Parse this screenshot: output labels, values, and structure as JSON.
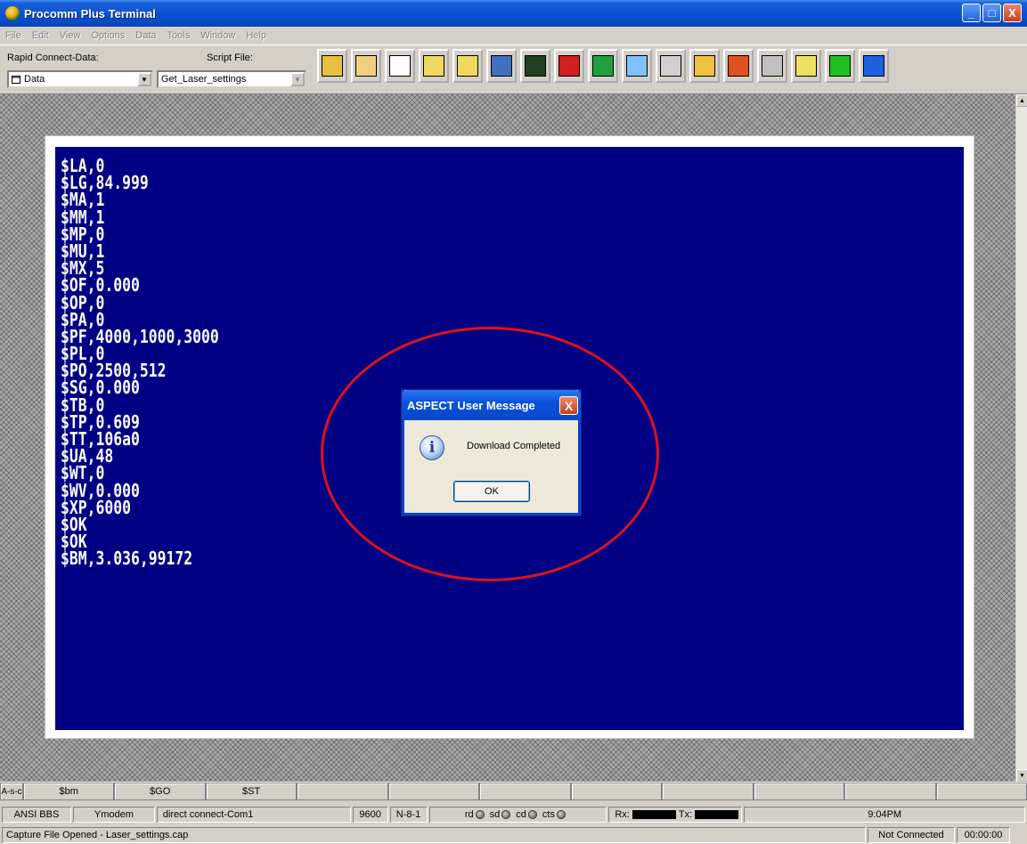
{
  "window": {
    "title": "Procomm Plus Terminal",
    "controls": {
      "minimize": "_",
      "maximize": "□",
      "close": "X"
    }
  },
  "menu": [
    "File",
    "Edit",
    "View",
    "Options",
    "Data",
    "Tools",
    "Window",
    "Help"
  ],
  "toolbar": {
    "rapid_connect_label": "Rapid Connect-Data:",
    "rapid_connect_value": "Data",
    "script_file_label": "Script File:",
    "script_file_value": "Get_Laser_settings",
    "dropdown_arrow": "▼",
    "tools": [
      {
        "name": "run-script-icon",
        "color": "#e8c040"
      },
      {
        "name": "phonebook-icon",
        "color": "#f0d080"
      },
      {
        "name": "mode-icon",
        "color": "#ffffff"
      },
      {
        "name": "send-file-icon",
        "color": "#f0d860"
      },
      {
        "name": "receive-file-icon",
        "color": "#f0d860"
      },
      {
        "name": "upload-fax-icon",
        "color": "#4070c0"
      },
      {
        "name": "terminal-dark-icon",
        "color": "#204020"
      },
      {
        "name": "phone-icon",
        "color": "#d02020"
      },
      {
        "name": "computer-icon",
        "color": "#20a040"
      },
      {
        "name": "clip-icon",
        "color": "#80c0ff"
      },
      {
        "name": "printer-icon",
        "color": "#d0d0d0"
      },
      {
        "name": "capture-icon",
        "color": "#f0c040"
      },
      {
        "name": "tools-icon",
        "color": "#e05020"
      },
      {
        "name": "keyboard-icon",
        "color": "#c0c0c0"
      },
      {
        "name": "bar-icon",
        "color": "#f0e060"
      },
      {
        "name": "meter-icon",
        "color": "#20c020"
      },
      {
        "name": "help-globe-icon",
        "color": "#2060e0"
      }
    ]
  },
  "terminal": {
    "lines": [
      "$LA,0",
      "$LG,84.999",
      "$MA,1",
      "$MM,1",
      "$MP,0",
      "$MU,1",
      "$MX,5",
      "$OF,0.000",
      "$OP,0",
      "$PA,0",
      "$PF,4000,1000,3000",
      "$PL,0",
      "$PO,2500,512",
      "$SG,0.000",
      "$TB,0",
      "$TP,0.609",
      "$TT,106a0",
      "$UA,48",
      "$WT,0",
      "$WV,0.000",
      "$XP,6000",
      "$OK",
      "$OK",
      "$BM,3.036,99172"
    ]
  },
  "dialog": {
    "title": "ASPECT User Message",
    "close": "X",
    "icon": "i",
    "message": "Download Completed",
    "ok_label": "OK"
  },
  "macros": {
    "ascii_label": "A-s-c",
    "items": [
      "$bm",
      "$GO",
      "$ST",
      "",
      "",
      "",
      "",
      "",
      "",
      "",
      ""
    ]
  },
  "status": {
    "emulation": "ANSI BBS",
    "protocol": "Ymodem",
    "connection": "direct connect-Com1",
    "baud": "9600",
    "parity": "N-8-1",
    "leds": [
      "rd",
      "sd",
      "cd",
      "cts"
    ],
    "rx_label": "Rx:",
    "tx_label": "Tx:",
    "time": "9:04PM"
  },
  "bottom": {
    "capture_text": "Capture File Opened - Laser_settings.cap",
    "connection_state": "Not Connected",
    "elapsed": "00:00:00"
  }
}
